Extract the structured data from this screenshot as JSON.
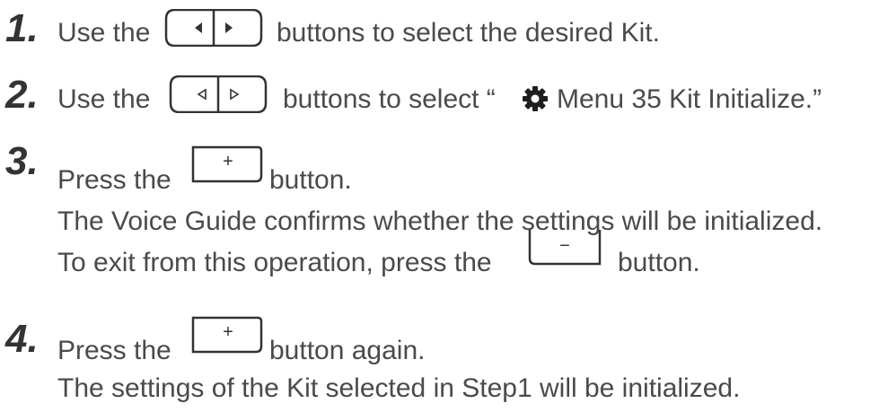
{
  "steps": [
    {
      "number": "1.",
      "pre": "Use the",
      "post": "buttons to select the desired Kit.",
      "buttons": "left-right-filled"
    },
    {
      "number": "2.",
      "pre": "Use the",
      "post_prefix": "buttons to select “",
      "post_suffix": "Menu 35 Kit Initialize.”",
      "buttons": "left-right-outline",
      "icon": "gear-icon"
    },
    {
      "number": "3.",
      "pre": "Press the",
      "post": "button.",
      "button": "plus",
      "lines": [
        "The Voice Guide confirms whether the settings will be initialized."
      ],
      "exit_pre": "To exit from this operation, press the",
      "exit_post": "button.",
      "exit_button": "minus"
    },
    {
      "number": "4.",
      "pre": "Press the",
      "post": "button again.",
      "button": "plus",
      "lines": [
        "The settings of the Kit selected in Step1 will be initialized."
      ]
    }
  ],
  "button_glyphs": {
    "plus": "+",
    "minus": "−"
  }
}
